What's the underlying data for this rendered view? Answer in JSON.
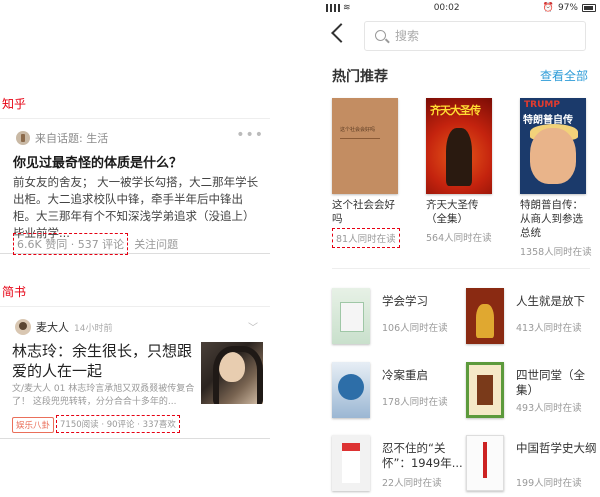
{
  "labels": {
    "zhihu": "知乎",
    "jianshu": "简书"
  },
  "zhihu_card": {
    "topic": "来自话题: 生活",
    "more": "•••",
    "title": "你见过最奇怪的体质是什么？",
    "excerpt": "前女友的舍友； 大一被学长勾搭，大二那年学长出柜。大二追求校队中锋，牵手半年后中锋出柜。大三那年有个不知深浅学弟追求（没追上）毕业前学...",
    "stats": "6.6K 赞同 · 537 评论",
    "follow": "关注问题"
  },
  "jianshu_card": {
    "author": "麦大人",
    "time": "14小时前",
    "title": "林志玲：余生很长，只想跟爱的人在一起",
    "excerpt": "文/麦大人 01 林志玲言承旭又双叒叕被传复合了！ 这段兜兜转转，分分合合十多年的...",
    "tag": "娱乐八卦",
    "stats": "7150阅读 · 90评论 · 337喜欢"
  },
  "status_bar": {
    "time": "00:02",
    "battery": "97%"
  },
  "search": {
    "placeholder": "搜索"
  },
  "hot": {
    "heading": "热门推荐",
    "view_all": "查看全部",
    "books": [
      {
        "title": "这个社会会好吗",
        "readers": "81人同时在读",
        "cover_text": "这个社会会好吗"
      },
      {
        "title": "齐天大圣传（全集）",
        "readers": "564人同时在读",
        "cover_text": "齐天大圣传"
      },
      {
        "title": "特朗普自传：从商人到参选总统",
        "readers": "1358人同时在读",
        "cover_text1": "TRUMP",
        "cover_text2": "特朗普自传"
      }
    ]
  },
  "list_books": [
    {
      "title": "学会学习",
      "readers": "106人同时在读"
    },
    {
      "title": "人生就是放下",
      "readers": "413人同时在读"
    },
    {
      "title": "冷案重启",
      "readers": "178人同时在读"
    },
    {
      "title": "四世同堂（全集）",
      "readers": "493人同时在读"
    },
    {
      "title": "忍不住的“关怀”：1949年...",
      "readers": "22人同时在读"
    },
    {
      "title": "中国哲学史大纲",
      "readers": "199人同时在读"
    }
  ],
  "colors": {
    "annotation_red": "#e60012",
    "link_blue": "#2e9cd8",
    "jianshu_tag": "#ea6f5a"
  }
}
